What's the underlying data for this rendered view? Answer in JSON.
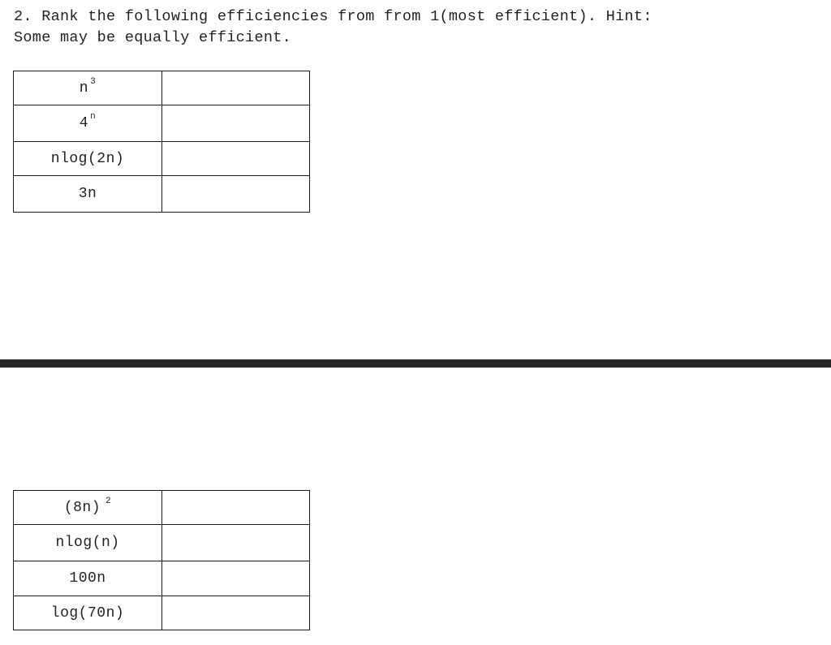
{
  "question": {
    "line1": "2. Rank the following efficiencies from from 1(most efficient). Hint:",
    "line2": "Some may be equally efficient."
  },
  "table_top": {
    "rows": [
      {
        "base": "n",
        "exponent": "3",
        "rank": ""
      },
      {
        "base": "4",
        "exponent": "n",
        "rank": ""
      },
      {
        "base": "nlog(2n)",
        "exponent": "",
        "rank": ""
      },
      {
        "base": "3n",
        "exponent": "",
        "rank": ""
      }
    ]
  },
  "table_bottom": {
    "rows": [
      {
        "base": "(8n)",
        "exponent": "2",
        "rank": ""
      },
      {
        "base": "nlog(n)",
        "exponent": "",
        "rank": ""
      },
      {
        "base": "100n",
        "exponent": "",
        "rank": ""
      },
      {
        "base": "log(70n)",
        "exponent": "",
        "rank": ""
      }
    ]
  },
  "colors": {
    "divider": "#262626",
    "text": "#222222",
    "border": "#1a1a1a"
  }
}
